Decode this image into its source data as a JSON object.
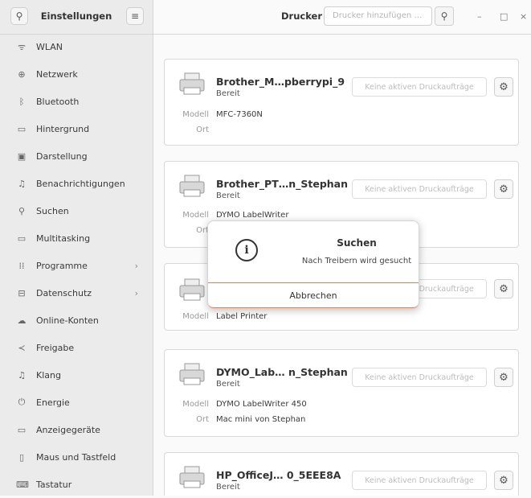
{
  "sidebar": {
    "title": "Einstellungen",
    "search_icon": "search-icon",
    "menu_icon": "hamburger-menu-icon",
    "items": [
      {
        "label": "WLAN",
        "icon": "wifi-icon"
      },
      {
        "label": "Netzwerk",
        "icon": "network-icon"
      },
      {
        "label": "Bluetooth",
        "icon": "bluetooth-icon"
      },
      {
        "label": "Hintergrund",
        "icon": "background-icon"
      },
      {
        "label": "Darstellung",
        "icon": "appearance-icon"
      },
      {
        "label": "Benachrichtigungen",
        "icon": "bell-icon"
      },
      {
        "label": "Suchen",
        "icon": "search-icon"
      },
      {
        "label": "Multitasking",
        "icon": "multitasking-icon"
      },
      {
        "label": "Programme",
        "icon": "apps-grid-icon"
      },
      {
        "label": "Datenschutz",
        "icon": "lock-icon"
      },
      {
        "label": "Online-Konten",
        "icon": "cloud-icon"
      },
      {
        "label": "Freigabe",
        "icon": "share-icon"
      },
      {
        "label": "Klang",
        "icon": "music-note-icon"
      },
      {
        "label": "Energie",
        "icon": "power-icon"
      },
      {
        "label": "Anzeigegeräte",
        "icon": "display-icon"
      },
      {
        "label": "Maus und Tastfeld",
        "icon": "mouse-icon"
      },
      {
        "label": "Tastatur",
        "icon": "keyboard-icon"
      }
    ]
  },
  "header": {
    "title": "Drucker",
    "add_placeholder": "Drucker hinzufügen …",
    "search_icon": "search-icon"
  },
  "window": {
    "minimize": "–",
    "maximize": "□",
    "close": "×"
  },
  "labels": {
    "model": "Modell",
    "location": "Ort"
  },
  "printers": [
    {
      "name": "Brother_M…pberrypi_9",
      "status": "Bereit",
      "jobs": "Keine aktiven Druckaufträge",
      "model": "MFC-7360N",
      "location": ""
    },
    {
      "name": "Brother_PT…n_Stephan",
      "status": "Bereit",
      "jobs": "Keine aktiven Druckaufträge",
      "model": "DYMO LabelWriter",
      "location": ""
    },
    {
      "name": "",
      "status": "",
      "jobs": "Keine aktiven Druckaufträge",
      "model": "Label Printer",
      "location": ""
    },
    {
      "name": "DYMO_Lab… n_Stephan",
      "status": "Bereit",
      "jobs": "Keine aktiven Druckaufträge",
      "model": "DYMO LabelWriter 450",
      "location": "Mac mini von Stephan"
    },
    {
      "name": "HP_OfficeJ… 0_5EEE8A",
      "status": "Bereit",
      "jobs": "Keine aktiven Druckaufträge",
      "model": "",
      "location": ""
    }
  ],
  "dialog": {
    "title": "Suchen",
    "message": "Nach Treibern wird gesucht",
    "cancel": "Abbrechen",
    "icon": "info-icon"
  },
  "colors": {
    "accent": "#e87b4d"
  }
}
